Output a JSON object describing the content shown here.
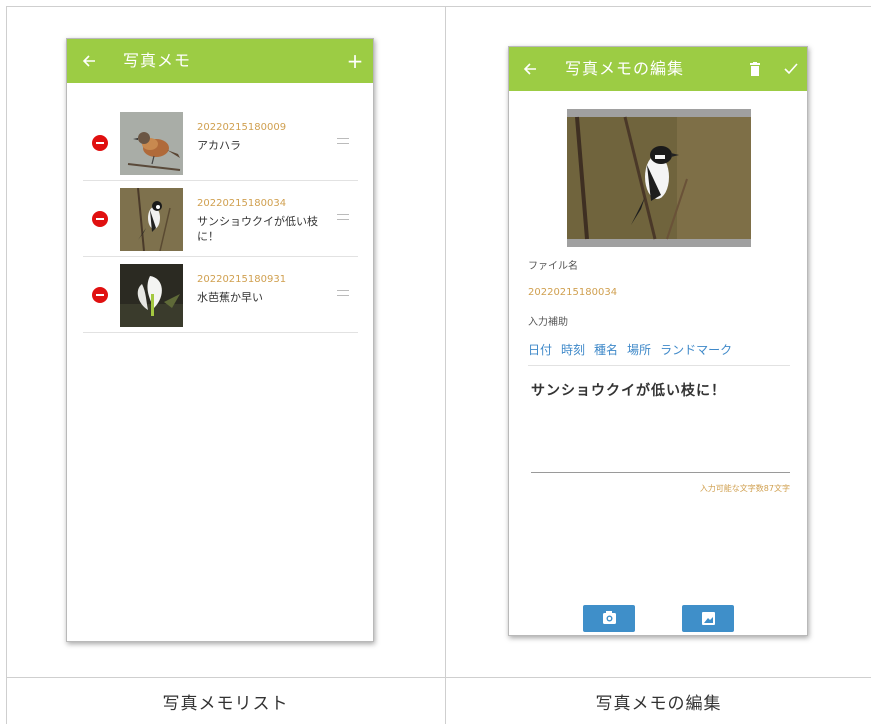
{
  "captions": {
    "left": "写真メモリスト",
    "right": "写真メモの編集"
  },
  "list_screen": {
    "title": "写真メモ",
    "back_icon": "arrow-left-icon",
    "add_icon": "plus-icon",
    "items": [
      {
        "file_id": "20220215180009",
        "memo": "アカハラ"
      },
      {
        "file_id": "20220215180034",
        "memo": "サンショウクイが低い枝に！"
      },
      {
        "file_id": "20220215180931",
        "memo": "水芭蕉か早い"
      }
    ]
  },
  "edit_screen": {
    "title": "写真メモの編集",
    "back_icon": "arrow-left-icon",
    "delete_icon": "trash-icon",
    "confirm_icon": "check-icon",
    "filename_label": "ファイル名",
    "filename_value": "20220215180034",
    "assist_label": "入力補助",
    "assist_buttons": [
      "日付",
      "時刻",
      "種名",
      "場所",
      "ランドマーク"
    ],
    "memo_text": "サンショウクイが低い枝に！",
    "counter": "入力可能な文字数87文字",
    "camera_icon": "camera-icon",
    "gallery_icon": "gallery-icon"
  },
  "colors": {
    "appbar": "#9ccc44",
    "accent_text": "#d0a050",
    "link": "#3f89c9",
    "button": "#3f8fc9",
    "delete": "#e01010"
  }
}
